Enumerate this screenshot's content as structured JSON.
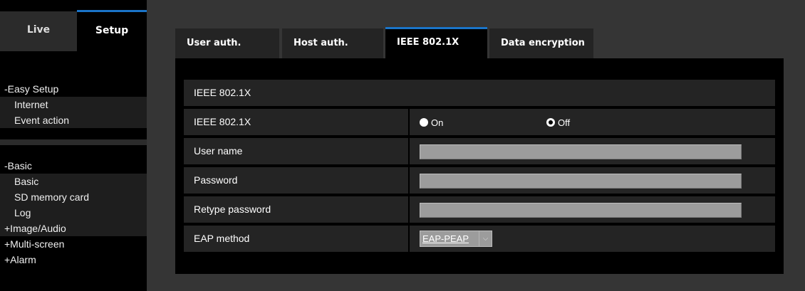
{
  "top_tabs": {
    "live": "Live",
    "setup": "Setup"
  },
  "sidebar": {
    "easy_setup": {
      "label": "-Easy Setup",
      "items": [
        "Internet",
        "Event action"
      ]
    },
    "basic": {
      "label": "-Basic",
      "items": [
        "Basic",
        "SD memory card",
        "Log"
      ]
    },
    "collapsed": [
      "+Image/Audio",
      "+Multi-screen",
      "+Alarm"
    ]
  },
  "tabs": [
    "User auth.",
    "Host auth.",
    "IEEE 802.1X",
    "Data encryption"
  ],
  "active_tab": "IEEE 802.1X",
  "section_title": "IEEE 802.1X",
  "rows": {
    "ieee": {
      "label": "IEEE 802.1X",
      "options": [
        "On",
        "Off"
      ],
      "selected": "Off"
    },
    "user_name": {
      "label": "User name",
      "value": ""
    },
    "password": {
      "label": "Password",
      "value": ""
    },
    "retype_password": {
      "label": "Retype password",
      "value": ""
    },
    "eap_method": {
      "label": "EAP method",
      "value": "EAP-PEAP"
    }
  },
  "colors": {
    "accent": "#1a74c8",
    "background": "#353535",
    "panel": "#000000",
    "row": "#242424"
  }
}
